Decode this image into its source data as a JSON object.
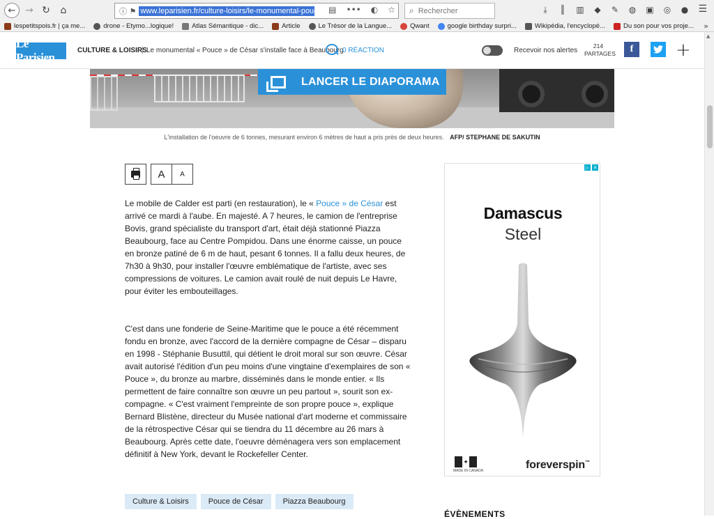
{
  "browser": {
    "url": "www.leparisien.fr/culture-loisirs/le-monumental-pouce-",
    "search_placeholder": "Rechercher",
    "bookmarks": [
      {
        "label": "lespetitspois.fr | ça me...",
        "color": "#8b3a1a"
      },
      {
        "label": "drone - Etymo...logique!",
        "color": "#555555"
      },
      {
        "label": "Atlas Sémantique - dic...",
        "color": "#777777"
      },
      {
        "label": "Article",
        "color": "#8b3a1a"
      },
      {
        "label": "Le Trésor de la Langue...",
        "color": "#555555"
      },
      {
        "label": "Qwant",
        "color": "#d8453a"
      },
      {
        "label": "google birthday surpri...",
        "color": "#4285f4"
      },
      {
        "label": "Wikipédia, l'encyclopé...",
        "color": "#555555"
      },
      {
        "label": "Du son pour vos proje...",
        "color": "#cc2222"
      }
    ]
  },
  "header": {
    "logo": "Le Parisien",
    "section": "CULTURE & LOISIRS",
    "separator": "|",
    "title": "Le monumental « Pouce » de César s'installe face à Beaubourg",
    "reactions": "0 RÉACTION",
    "alerts_label": "Recevoir nos alertes",
    "shares_count": "214",
    "shares_label": "PARTAGES",
    "facebook": "f",
    "twitter": "t",
    "plus": "+",
    "brand_color": "#2a91d9"
  },
  "media": {
    "slideshow_label": "LANCER LE DIAPORAMA",
    "caption": "L'installation de l'oeuvre de 6 tonnes, mesurant environ 6 mètres de haut a pris près de deux heures.",
    "credit": "AFP/ STEPHANE DE SAKUTIN"
  },
  "tools": {
    "font_big": "A",
    "font_small": "A"
  },
  "article": {
    "p1_before": "Le mobile de Calder est parti (en restauration), le « ",
    "p1_link": "Pouce » de César",
    "p1_after": " est arrivé ce mardi à l'aube. En majesté. A 7 heures, le camion de l'entreprise Bovis, grand spécialiste du transport d'art, était déjà stationné Piazza Beaubourg, face au Centre Pompidou. Dans une énorme caisse, un pouce en bronze patiné de 6 m de haut, pesant 6 tonnes. Il a fallu deux heures, de 7h30 à 9h30, pour installer l'œuvre emblématique de l'artiste, avec ses compressions de voitures. Le camion avait roulé de nuit depuis Le Havre, pour éviter les embouteillages.",
    "p2": "C'est dans une fonderie de Seine-Maritime que le pouce a été récemment fondu en bronze, avec l'accord de la dernière compagne de César – disparu en 1998 - Stéphanie Busuttil, qui détient le droit moral sur son œuvre. César avait autorisé l'édition d'un peu moins d'une vingtaine d'exemplaires de son « Pouce », du bronze au marbre, disséminés dans le monde entier. « Ils permettent de faire connaître son œuvre un peu partout », sourit son ex-compagne. « C'est vraiment l'empreinte de son propre pouce », explique Bernard Blistène, directeur du Musée national d'art moderne et commissaire de la rétrospective César qui se tiendra du 11 décembre au 26 mars à Beaubourg. Après cette date, l'oeuvre déménagera vers son emplacement définitif à New York, devant le Rockefeller Center."
  },
  "tags": [
    "Culture & Loisirs",
    "Pouce de César",
    "Piazza Beaubourg"
  ],
  "ad": {
    "title": "Damascus",
    "subtitle": "Steel",
    "brand": "foreverspin",
    "brand_mark": "™",
    "made_in": "MADE IN CANADA",
    "maple": "✦"
  },
  "sidebar": {
    "events_heading": "ÉVÈNEMENTS"
  }
}
